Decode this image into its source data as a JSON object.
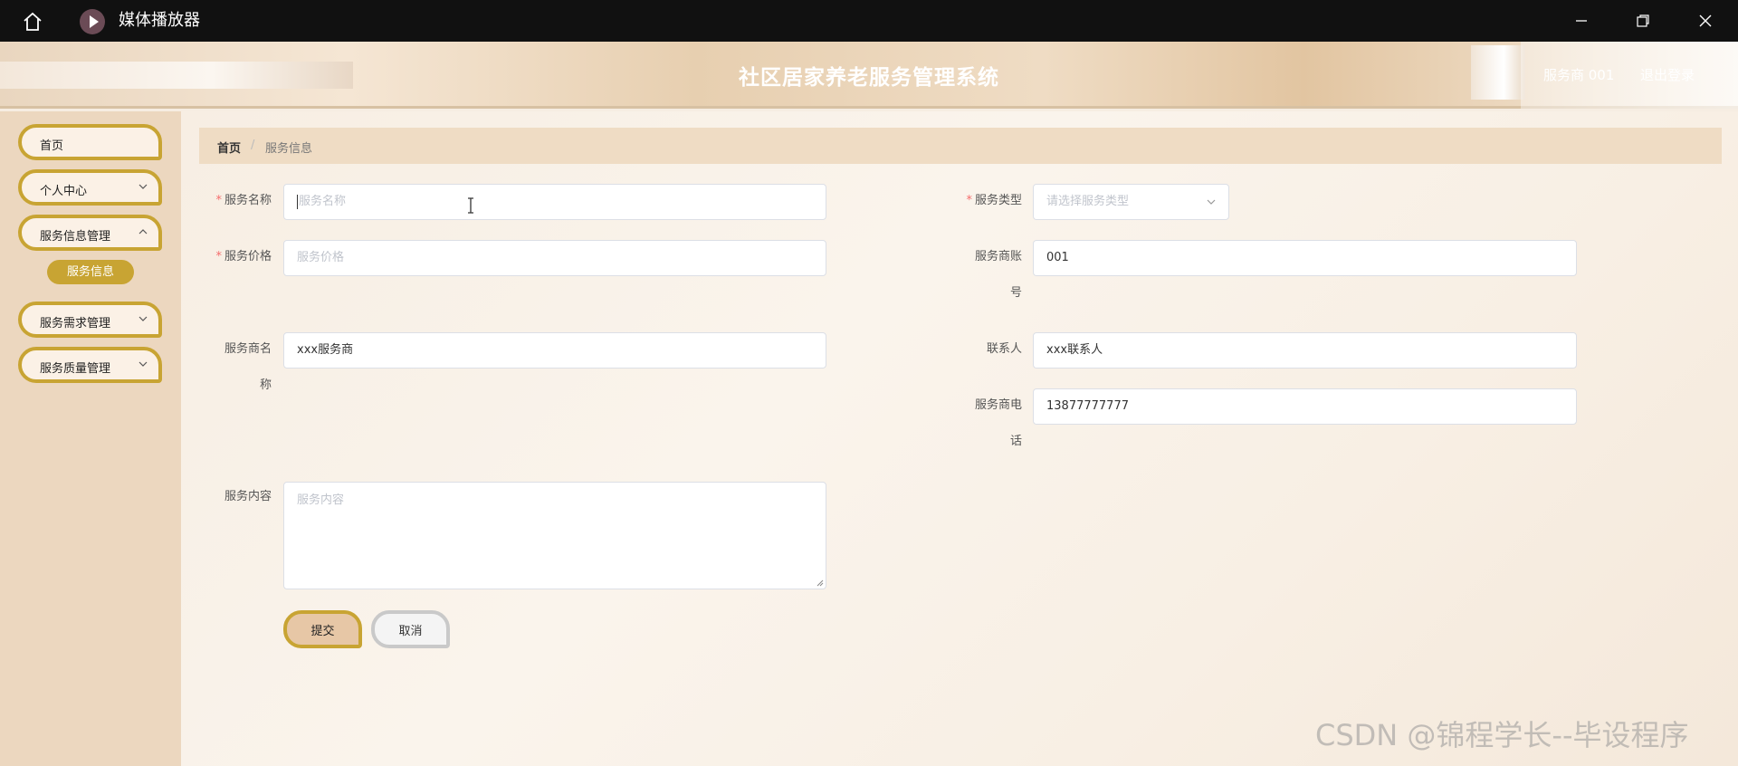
{
  "window": {
    "title": "媒体播放器"
  },
  "header": {
    "system_title": "社区居家养老服务管理系统",
    "user": "服务商 001",
    "logout": "退出登录"
  },
  "sidebar": {
    "items": [
      {
        "label": "首页"
      },
      {
        "label": "个人中心"
      },
      {
        "label": "服务信息管理"
      },
      {
        "label": "服务需求管理"
      },
      {
        "label": "服务质量管理"
      }
    ],
    "sub_active": "服务信息"
  },
  "breadcrumb": {
    "home": "首页",
    "separator": "/",
    "current": "服务信息"
  },
  "form": {
    "service_name": {
      "label": "服务名称",
      "required": true,
      "placeholder": "服务名称",
      "value": ""
    },
    "service_type": {
      "label": "服务类型",
      "required": true,
      "placeholder": "请选择服务类型",
      "value": ""
    },
    "service_price": {
      "label": "服务价格",
      "required": true,
      "placeholder": "服务价格",
      "value": ""
    },
    "provider_account": {
      "label_line1": "服务商账",
      "label_line2": "号",
      "value": "001"
    },
    "provider_name": {
      "label_line1": "服务商名",
      "label_line2": "称",
      "value": "xxx服务商"
    },
    "contact": {
      "label": "联系人",
      "value": "xxx联系人"
    },
    "provider_phone": {
      "label_line1": "服务商电",
      "label_line2": "话",
      "value": "13877777777"
    },
    "service_content": {
      "label": "服务内容",
      "placeholder": "服务内容",
      "value": ""
    },
    "submit": "提交",
    "cancel": "取消"
  },
  "watermark": "CSDN @锦程学长--毕设程序",
  "colors": {
    "accent": "#c8a433",
    "sidebar_bg": "#ecd7bf",
    "required": "#f56c6c",
    "titlebar": "#111111"
  }
}
